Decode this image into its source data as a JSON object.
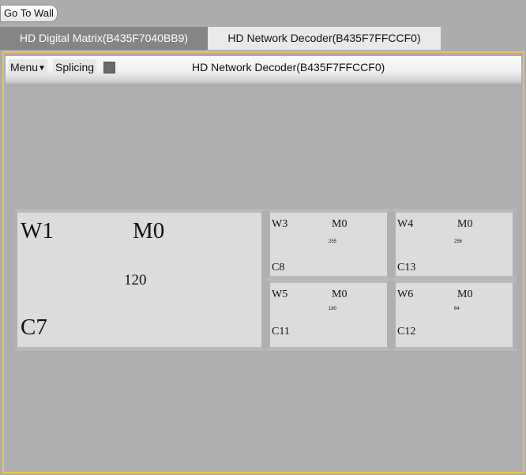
{
  "top": {
    "go_to_wall_label": "Go To Wall"
  },
  "tabs": [
    {
      "label": "HD Digital Matrix(B435F7040BB9)",
      "active": false
    },
    {
      "label": "HD Network Decoder(B435F7FFCCF0)",
      "active": true
    }
  ],
  "toolbar": {
    "menu_label": "Menu",
    "menu_arrow": "▼",
    "splicing_label": "Splicing",
    "splicing_toggle": {
      "checked": true,
      "color": "#6a6a6a"
    },
    "title": "HD Network Decoder(B435F7FFCCF0)"
  },
  "colors": {
    "accent_border": "#efc05a",
    "background": "#acacac",
    "window_fill": "#dcdcdc",
    "active_tab": "#e9e9e9",
    "inactive_tab": "#858585"
  },
  "windows": [
    {
      "id": "W1",
      "mode": "M0",
      "value": "120",
      "channel": "C7"
    },
    {
      "id": "W3",
      "mode": "M0",
      "value": "255",
      "channel": "C8"
    },
    {
      "id": "W4",
      "mode": "M0",
      "value": "256",
      "channel": "C13"
    },
    {
      "id": "W5",
      "mode": "M0",
      "value": "180",
      "channel": "C11"
    },
    {
      "id": "W6",
      "mode": "M0",
      "value": "64",
      "channel": "C12"
    }
  ]
}
